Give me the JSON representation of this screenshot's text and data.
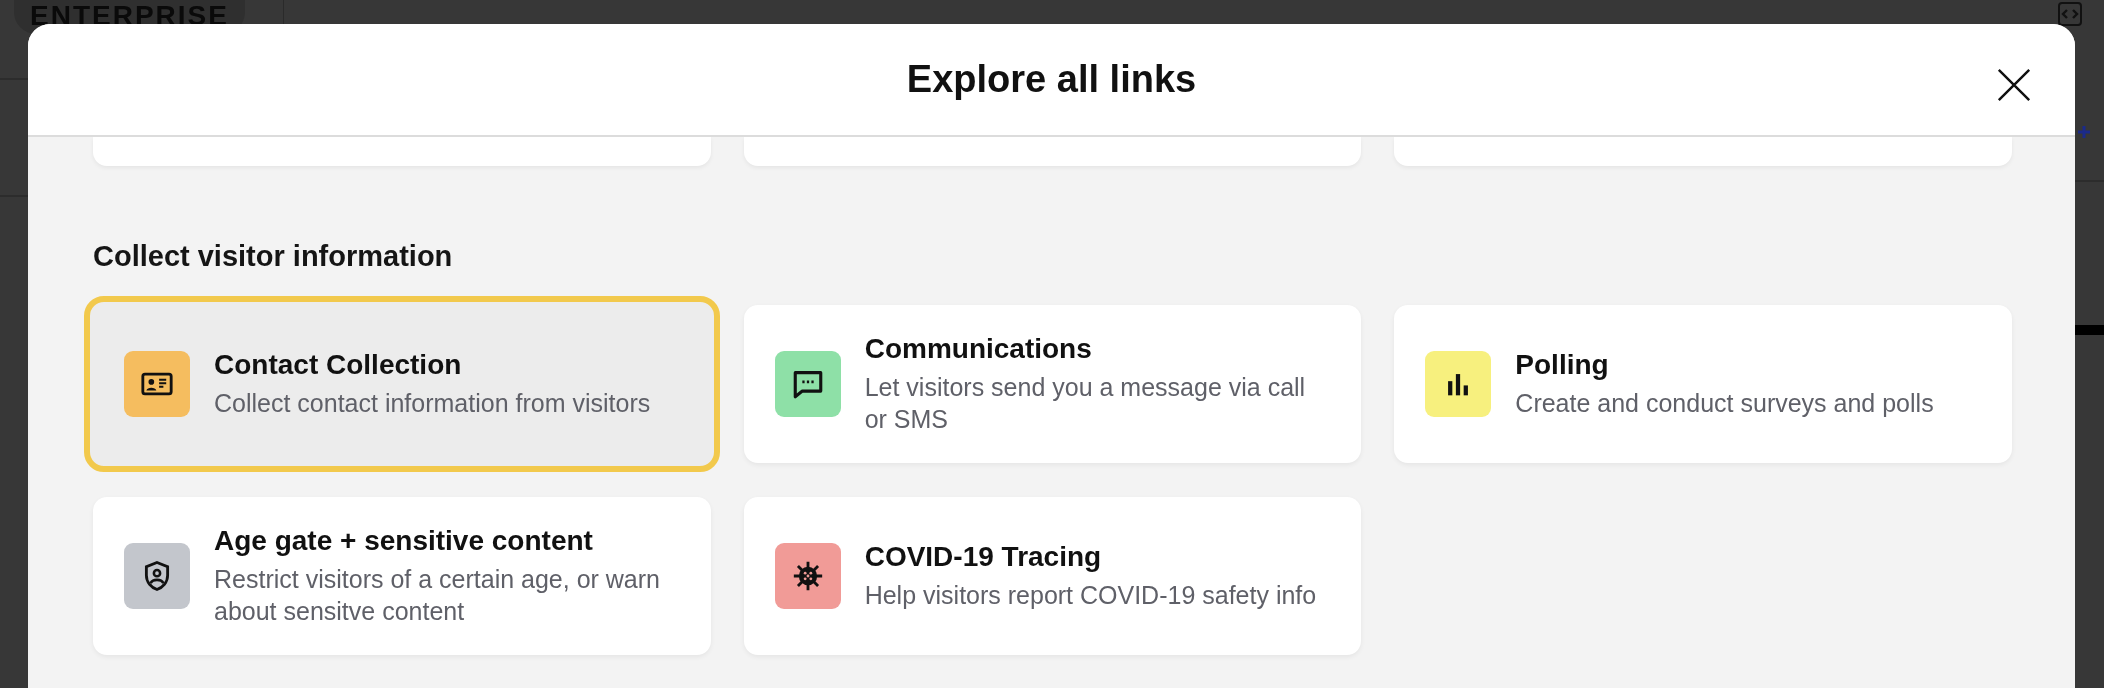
{
  "background": {
    "badge": "ENTERPRISE"
  },
  "modal": {
    "title": "Explore all links"
  },
  "section": {
    "heading": "Collect visitor information",
    "cards": [
      {
        "kind": "contact",
        "title": "Contact Collection",
        "description": "Collect contact information from visitors",
        "color": "#f5bd5f",
        "selected": true
      },
      {
        "kind": "chat",
        "title": "Communications",
        "description": "Let visitors send you a message via call or SMS",
        "color": "#8ee0a7",
        "selected": false
      },
      {
        "kind": "poll",
        "title": "Polling",
        "description": "Create and conduct surveys and polls",
        "color": "#f7f07e",
        "selected": false
      },
      {
        "kind": "shield",
        "title": "Age gate + sensitive content",
        "description": "Restrict visitors of a certain age, or warn about sensitve content",
        "color": "#c3c6cc",
        "selected": false
      },
      {
        "kind": "virus",
        "title": "COVID-19 Tracing",
        "description": "Help visitors report COVID-19 safety info",
        "color": "#f19b97",
        "selected": false
      }
    ]
  }
}
